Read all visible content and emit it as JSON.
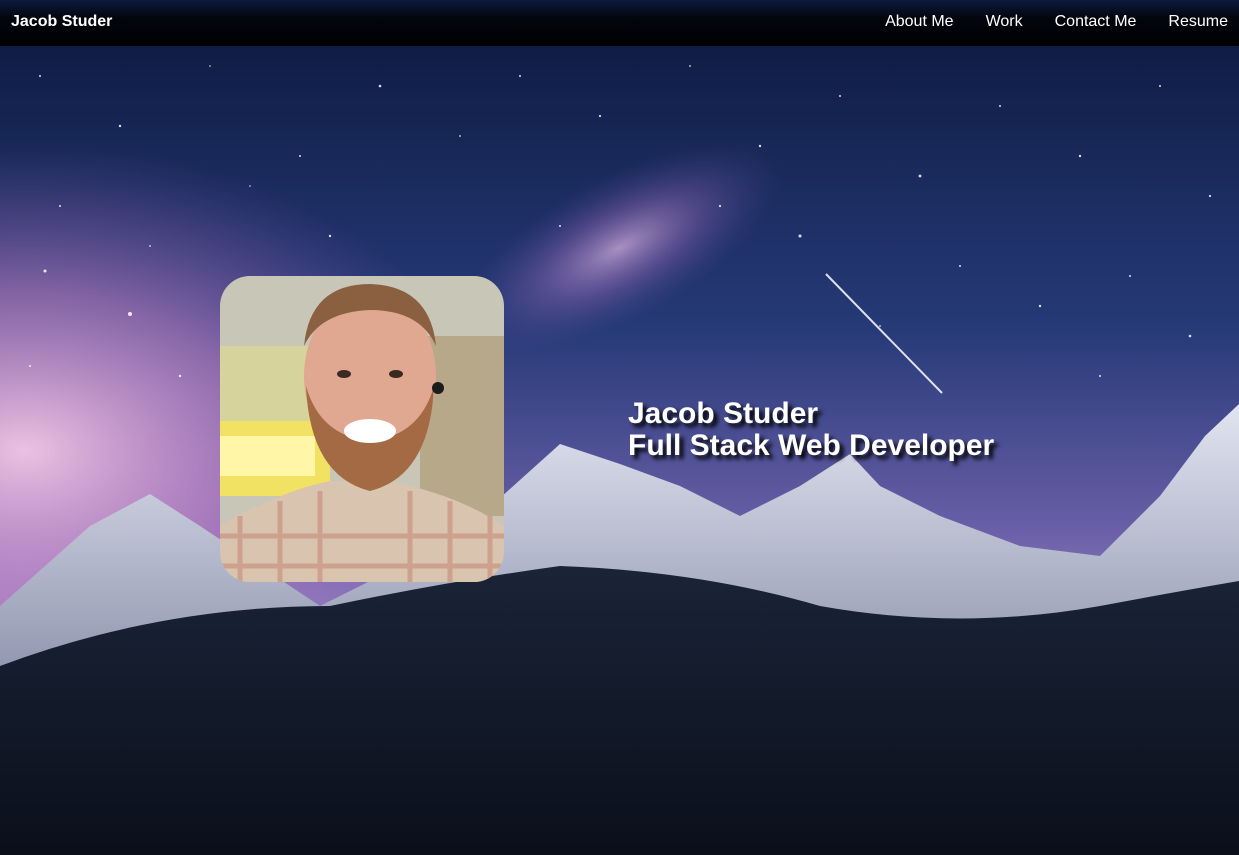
{
  "navbar": {
    "brand": "Jacob Studer",
    "links": [
      {
        "label": "About Me"
      },
      {
        "label": "Work"
      },
      {
        "label": "Contact Me"
      },
      {
        "label": "Resume"
      }
    ]
  },
  "hero": {
    "name": "Jacob Studer",
    "tagline": "Full Stack Web Developer",
    "background_image": "night-sky-mountains",
    "portrait_image": "profile-photo"
  },
  "colors": {
    "navbar_top": "#0d1a3d",
    "navbar_bottom": "#000000",
    "text": "#ffffff",
    "sky_top": "#0f1d45",
    "sky_purple": "#b06bb0",
    "mountain_snow": "#c9cde0",
    "forest": "#0e1626"
  }
}
